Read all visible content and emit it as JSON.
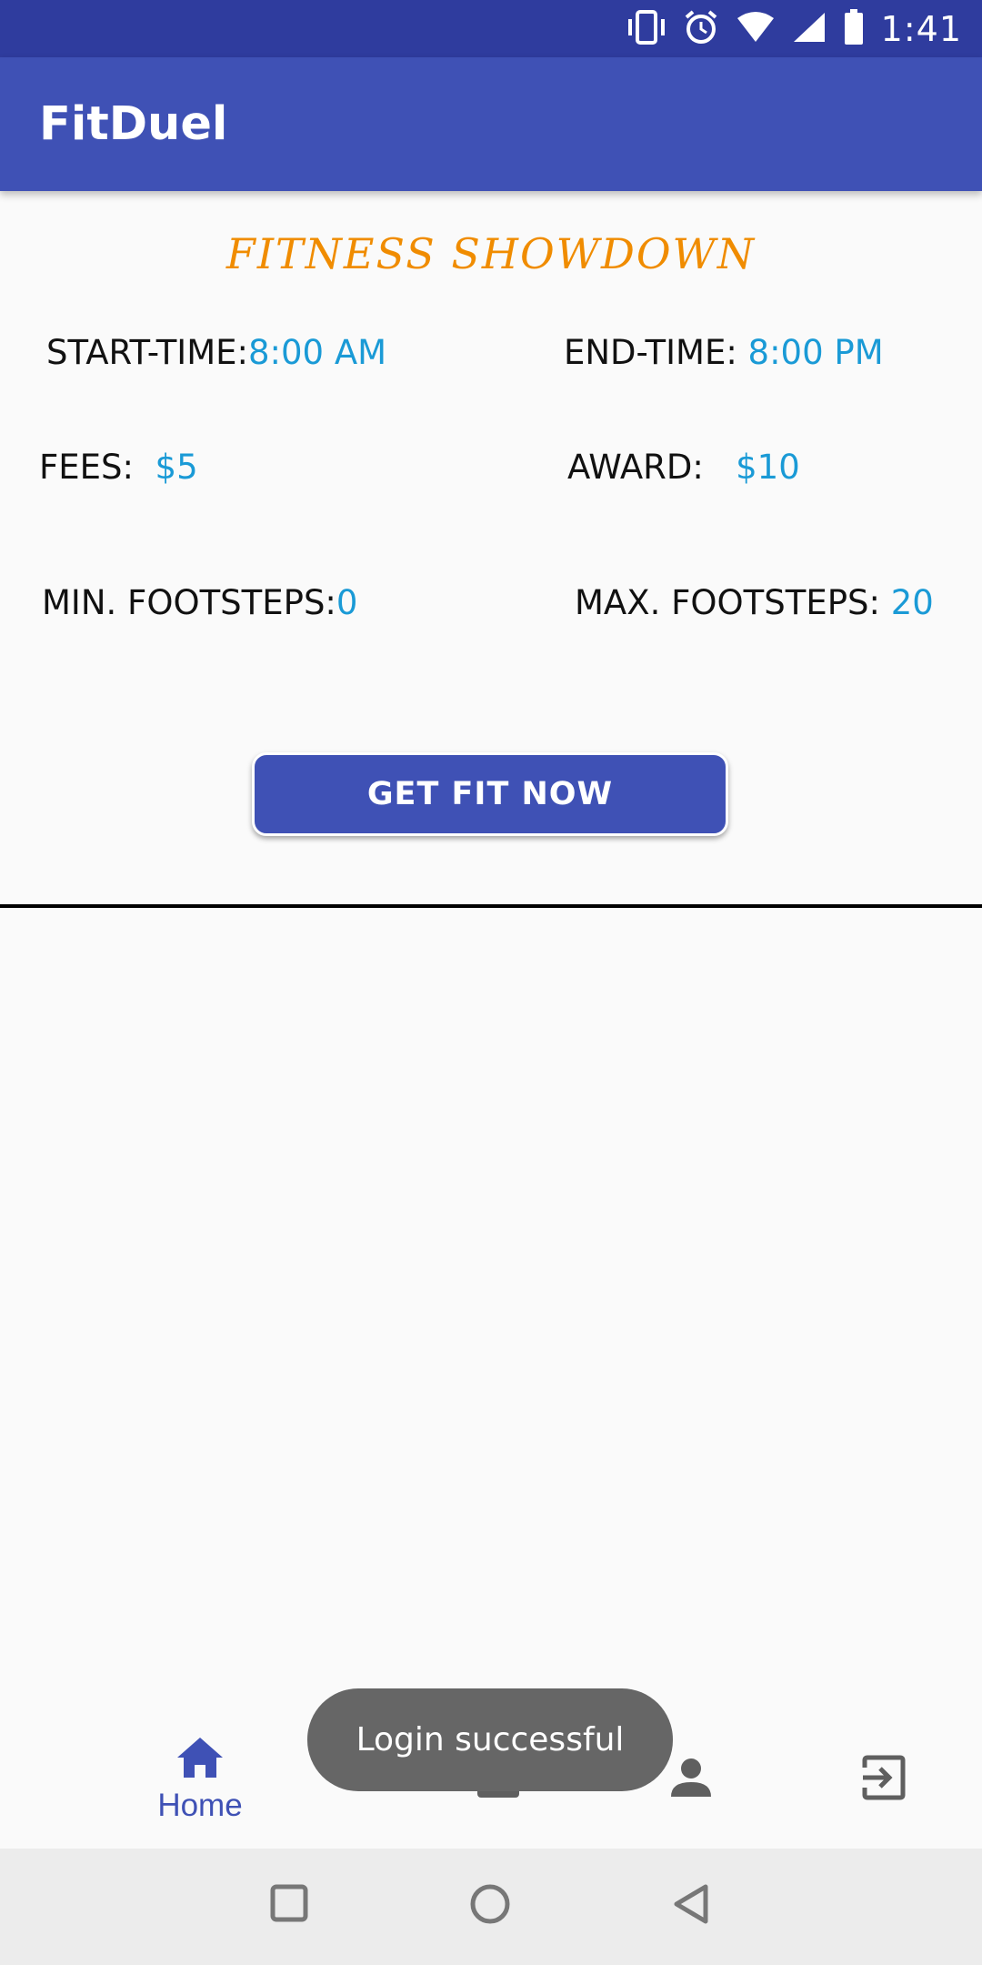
{
  "status_bar": {
    "time": "1:41",
    "icons": [
      "vibrate-icon",
      "alarm-icon",
      "wifi-icon",
      "signal-icon",
      "battery-icon"
    ]
  },
  "app_bar": {
    "title": "FitDuel"
  },
  "challenge": {
    "heading": "FITNESS SHOWDOWN",
    "start_time_label": "START-TIME:",
    "start_time_value": "8:00 AM",
    "end_time_label": "END-TIME:",
    "end_time_value": "8:00 PM",
    "fees_label": "FEES:",
    "fees_value": "$5",
    "award_label": "AWARD:",
    "award_value": "$10",
    "min_steps_label": "MIN. FOOTSTEPS:",
    "min_steps_value": "0",
    "max_steps_label": "MAX. FOOTSTEPS:",
    "max_steps_value": "20",
    "button_label": "GET FIT NOW"
  },
  "bottom_nav": {
    "items": [
      {
        "label": "Home",
        "icon": "home-icon",
        "active": true
      },
      {
        "label": "",
        "icon": "wallet-icon",
        "active": false
      },
      {
        "label": "",
        "icon": "person-icon",
        "active": false
      },
      {
        "label": "",
        "icon": "logout-icon",
        "active": false
      }
    ]
  },
  "toast": {
    "message": "Login successful"
  },
  "colors": {
    "primary": "#3f51b5",
    "primary_dark": "#2f3c9e",
    "accent_value": "#1a9ad6",
    "heading": "#f08c00"
  }
}
